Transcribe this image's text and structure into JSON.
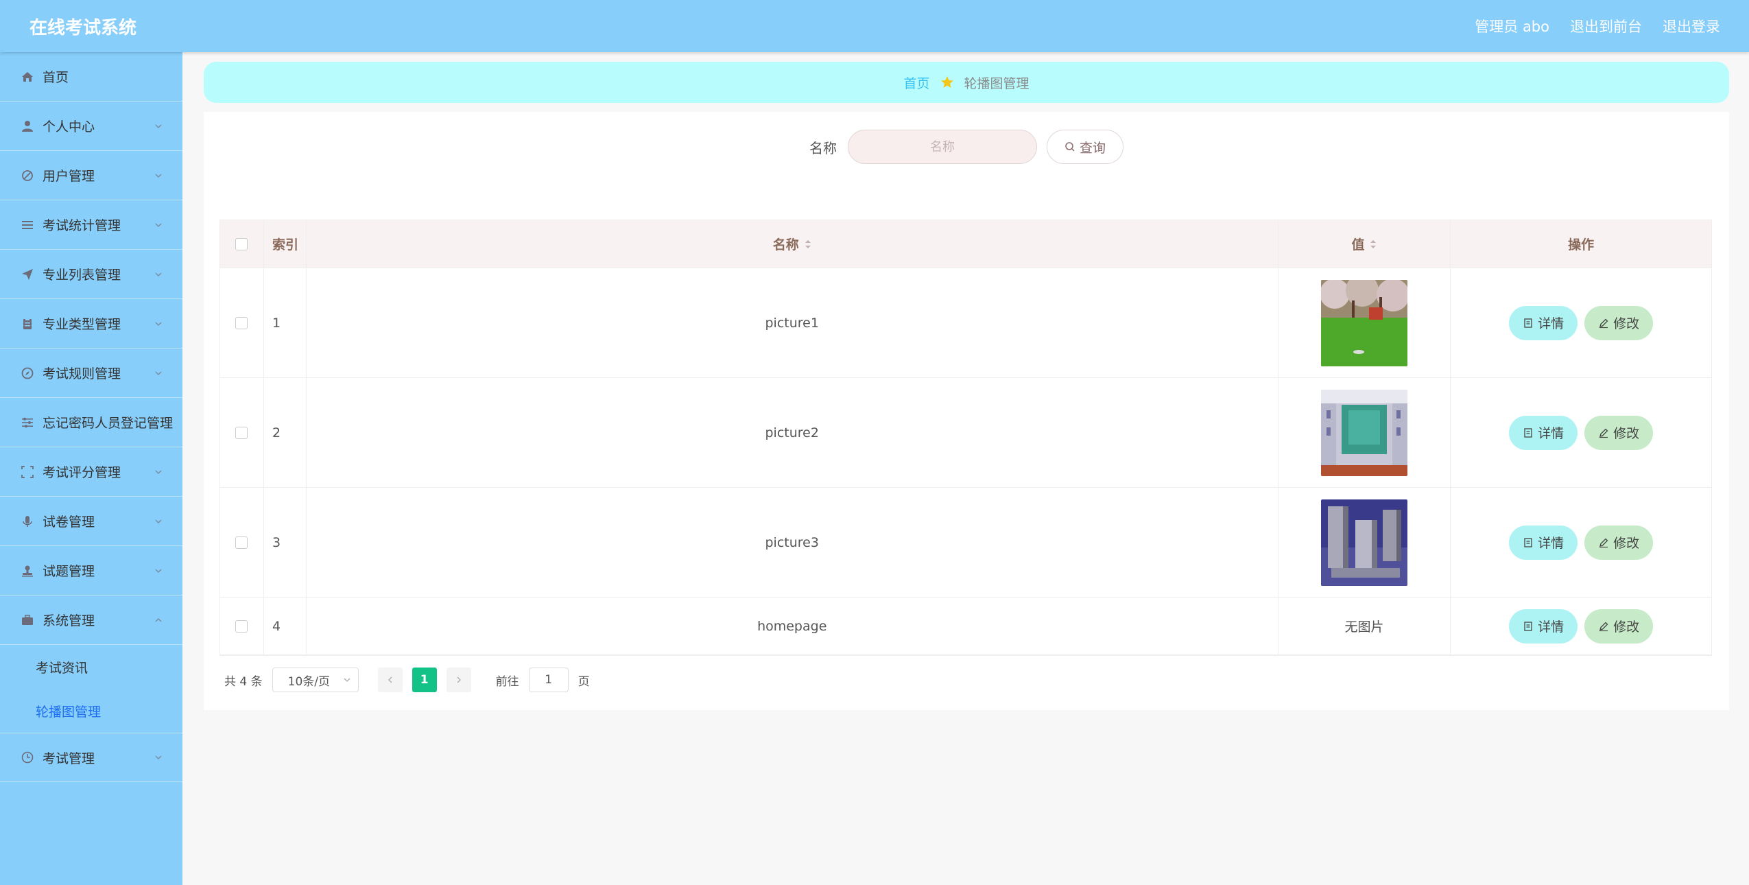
{
  "header": {
    "title": "在线考试系统",
    "admin_label": "管理员 abo",
    "back_front": "退出到前台",
    "logout": "退出登录"
  },
  "sidebar": {
    "items": [
      {
        "label": "首页",
        "icon": "home-icon"
      },
      {
        "label": "个人中心",
        "icon": "user-icon"
      },
      {
        "label": "用户管理",
        "icon": "slash-circle-icon"
      },
      {
        "label": "考试统计管理",
        "icon": "list-icon"
      },
      {
        "label": "专业列表管理",
        "icon": "send-icon"
      },
      {
        "label": "专业类型管理",
        "icon": "clipboard-icon"
      },
      {
        "label": "考试规则管理",
        "icon": "compass-icon"
      },
      {
        "label": "忘记密码人员登记管理",
        "icon": "sliders-icon"
      },
      {
        "label": "考试评分管理",
        "icon": "fullscreen-icon"
      },
      {
        "label": "试卷管理",
        "icon": "microphone-icon"
      },
      {
        "label": "试题管理",
        "icon": "person-stamp-icon"
      },
      {
        "label": "系统管理",
        "icon": "suitcase-icon"
      },
      {
        "label": "考试管理",
        "icon": "clock-icon"
      }
    ],
    "submenu": [
      {
        "label": "考试资讯"
      },
      {
        "label": "轮播图管理"
      }
    ]
  },
  "breadcrumb": {
    "home": "首页",
    "current": "轮播图管理"
  },
  "search": {
    "label": "名称",
    "placeholder": "名称",
    "button": "查询"
  },
  "table": {
    "headers": {
      "index": "索引",
      "name": "名称",
      "value": "值",
      "ops": "操作"
    },
    "rows": [
      {
        "index": "1",
        "name": "picture1",
        "value_type": "image",
        "image": "park"
      },
      {
        "index": "2",
        "name": "picture2",
        "value_type": "image",
        "image": "classroom"
      },
      {
        "index": "3",
        "name": "picture3",
        "value_type": "image",
        "image": "building"
      },
      {
        "index": "4",
        "name": "homepage",
        "value_type": "text",
        "value_text": "无图片"
      }
    ],
    "detail_label": "详情",
    "edit_label": "修改"
  },
  "pagination": {
    "total": "共 4 条",
    "page_size": "10条/页",
    "current_page": "1",
    "goto_label": "前往",
    "goto_value": "1",
    "page_unit": "页"
  },
  "colors": {
    "header_bg": "#87cefa",
    "breadcrumb_bg": "#b9fcfd",
    "detail_btn": "#aef3f3",
    "edit_btn": "#c7ebc9",
    "active_page": "#13c287"
  }
}
